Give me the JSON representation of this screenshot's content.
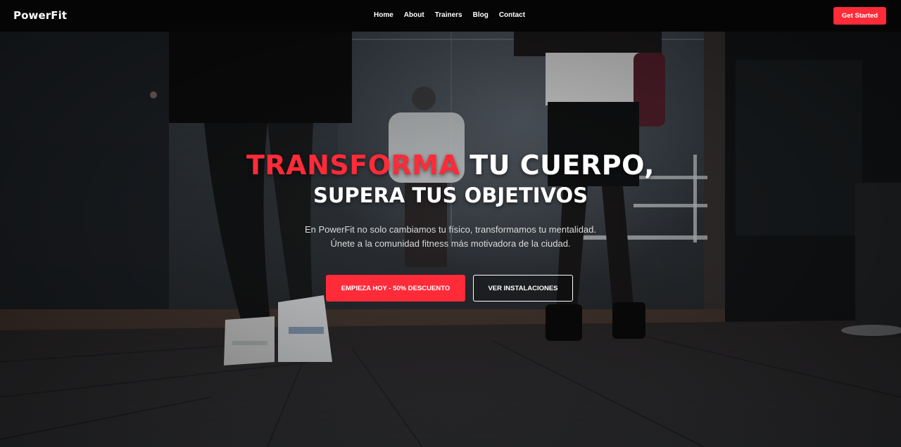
{
  "nav": {
    "brand": "PowerFit",
    "links": [
      "Home",
      "About",
      "Trainers",
      "Blog",
      "Contact"
    ],
    "cta_label": "Get Started"
  },
  "hero": {
    "title_accent": "TRANSFORMA",
    "title_rest": " TU CUERPO,",
    "title_line2": "SUPERA TUS OBJETIVOS",
    "subtitle_line1": "En PowerFit no solo cambiamos tu físico, transformamos tu mentalidad.",
    "subtitle_line2": "Únete a la comunidad fitness más motivadora de la ciudad.",
    "primary_button": "EMPIEZA HOY - 50% DESCUENTO",
    "secondary_button": "VER INSTALACIONES"
  },
  "colors": {
    "accent": "#ff2b39",
    "navbar": "#050505"
  }
}
